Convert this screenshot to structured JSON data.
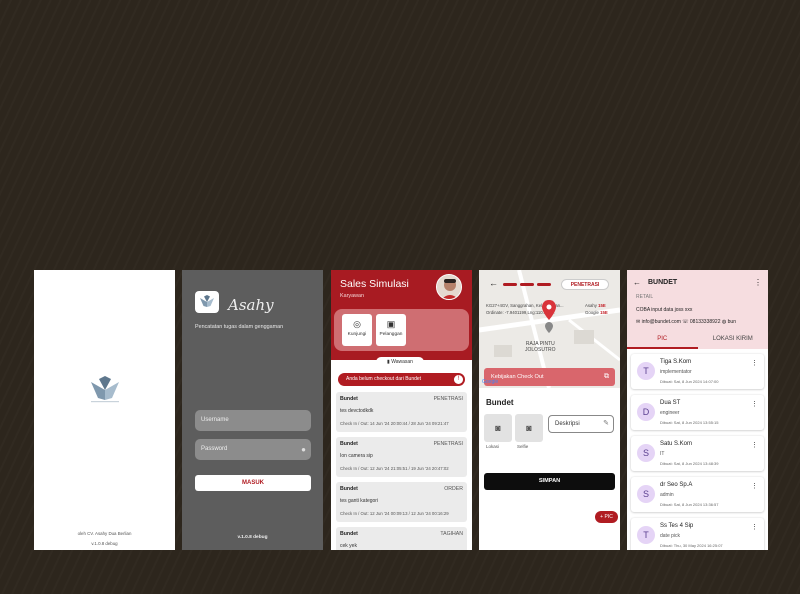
{
  "splash": {
    "credit": "oleh CV. Asahy Dua Berlian",
    "version": "v.1.0.8 debug"
  },
  "login": {
    "brand": "Asahy",
    "tagline": "Pencatatan tugas dalam genggaman",
    "username_placeholder": "Username",
    "password_placeholder": "Password",
    "submit_label": "MASUK",
    "version": "v.1.0.8 debug"
  },
  "dashboard": {
    "title": "Sales Simulasi",
    "role": "Karyawan",
    "menu": [
      {
        "label": "Kunjungi",
        "icon": "location-pin-icon"
      },
      {
        "label": "Pelanggan",
        "icon": "contact-card-icon"
      }
    ],
    "tab_label": "Wawasan",
    "alert": "Anda belum checkout dari Bundet",
    "visits": [
      {
        "store": "Bundet",
        "type": "PENETRASI",
        "note": "tes devctodkdk",
        "times": "Check In / Out: 14 Jun '24 20:00:44 / 28 Jun '24 09:21:47"
      },
      {
        "store": "Bundet",
        "type": "PENETRASI",
        "note": "Ion camera sip",
        "times": "Check In / Out: 12 Jun '24 21:05:51 / 19 Jun '24 20:47:02"
      },
      {
        "store": "Bundet",
        "type": "ORDER",
        "note": "tes ganti kategori",
        "times": "Check In / Out: 12 Jun '24 00:09:13 / 12 Jun '24 00:16:29"
      },
      {
        "store": "Bundet",
        "type": "TAGIHAN",
        "note": "cek yek",
        "times": ""
      }
    ]
  },
  "checkout": {
    "visit_type": "PENETRASI",
    "coords_line1": "KG27+4GV, Sanggrahan, Kel Kelingan...",
    "coords_line2": "Ordinate: -7.9401199,Lng:110.373...",
    "accuracy_device_label": "Asahy",
    "accuracy_device_value": "15E",
    "accuracy_google_label": "Google",
    "accuracy_google_value": "15E",
    "place_line1": "RAJA PINTU",
    "place_line2": "JOLOSUTRO",
    "map_attribution": "Google",
    "policy_label": "Kebijakan Check Out",
    "store": "Bundet",
    "photo_labels": [
      "Lokasi",
      "Selfie"
    ],
    "description_placeholder": "Deskripsi",
    "save_label": "SIMPAN",
    "fab_label": "+ PIC"
  },
  "store": {
    "name": "BUNDET",
    "category": "RETAIL",
    "address": "COBA input data joss xxx",
    "email": "info@bundet.com",
    "phone": "08133338922",
    "website": "bun",
    "tabs": [
      "PIC",
      "LOKASI KIRIM"
    ],
    "pics": [
      {
        "initial": "T",
        "name": "Tiga S.Kom",
        "role": "implementator",
        "date": "Dibuat: Sat, 8 Jun 2024 14:07:00"
      },
      {
        "initial": "D",
        "name": "Dua ST",
        "role": "engineer",
        "date": "Dibuat: Sat, 8 Jun 2024 13:55:15"
      },
      {
        "initial": "S",
        "name": "Satu S.Kom",
        "role": "IT",
        "date": "Dibuat: Sat, 8 Jun 2024 13:48:39"
      },
      {
        "initial": "S",
        "name": "dr Seo Sp.A",
        "role": "admin",
        "date": "Dibuat: Sat, 8 Jun 2024 13:36:57"
      },
      {
        "initial": "T",
        "name": "Ss Tes 4 Sip",
        "role": "date pick",
        "date": "Dibuat: Thu, 30 May 2024 16:25:07"
      }
    ]
  },
  "colors": {
    "brand_red": "#b01c22",
    "header_pink": "#f6dde0",
    "avatar_lavender": "#e5d4f6",
    "login_bg": "#5d5d5d"
  }
}
